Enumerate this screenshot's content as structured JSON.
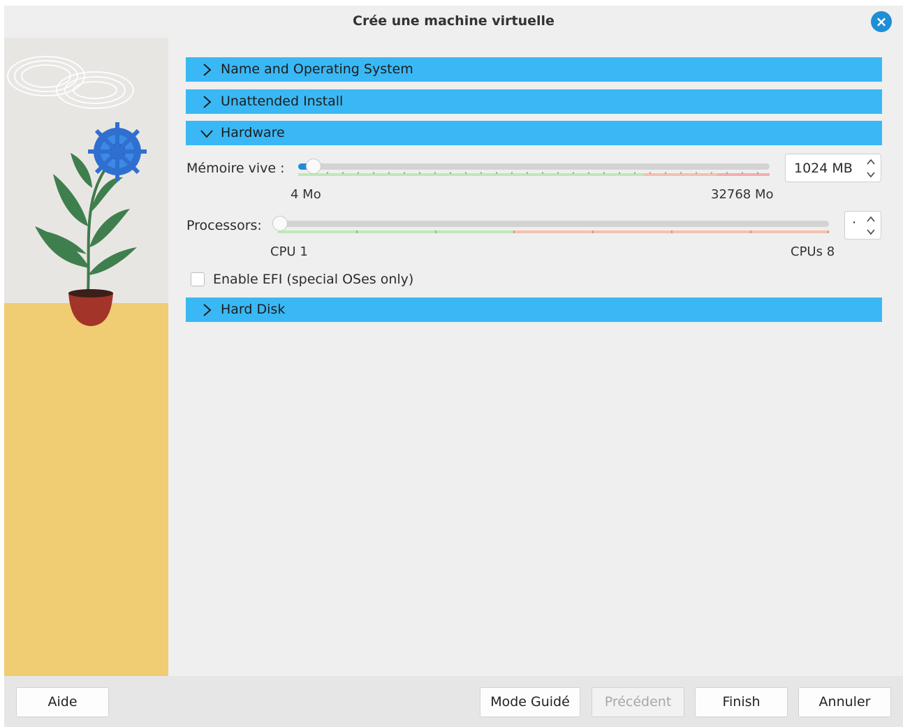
{
  "window": {
    "title": "Crée une machine virtuelle"
  },
  "sections": {
    "name_os": "Name and Operating System",
    "unattended": "Unattended Install",
    "hardware": "Hardware",
    "hard_disk": "Hard Disk"
  },
  "hardware": {
    "memory": {
      "label": "Mémoire vive :",
      "min_label": "4 Mo",
      "max_label": "32768 Mo",
      "value": "1024 MB",
      "fraction": 0.031
    },
    "processors": {
      "label": "Processors:",
      "min_label": "CPU 1",
      "max_label": "CPUs 8",
      "value": "·",
      "fraction": 0.0
    },
    "efi": {
      "label": "Enable EFI (special OSes only)",
      "checked": false
    }
  },
  "footer": {
    "help": "Aide",
    "guided": "Mode Guidé",
    "previous": "Précédent",
    "finish": "Finish",
    "cancel": "Annuler"
  },
  "colors": {
    "section_bg": "#3ab8f5",
    "accent": "#1e8fd6",
    "scale_ok": "#bde9b5",
    "scale_warn": "#f4c2b0",
    "scale_bad": "#f2aeb0"
  },
  "icons": {
    "close": "close-icon",
    "collapsed": "chevron-right-icon",
    "expanded": "chevron-down-icon",
    "spin": "spin-arrows-icon"
  }
}
